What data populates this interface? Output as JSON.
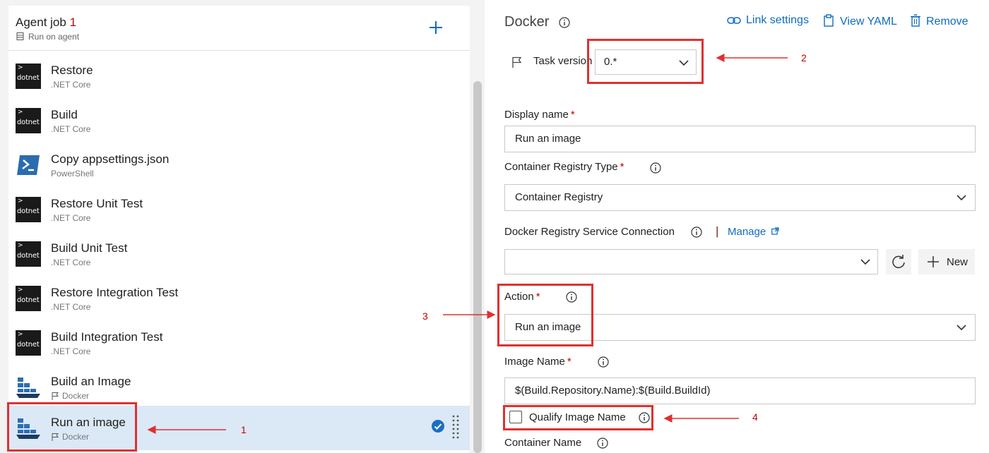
{
  "left": {
    "job": {
      "title": "Agent job",
      "number": "1",
      "subtitle": "Run on agent"
    },
    "tasks": [
      {
        "name": "Restore",
        "subtitle": ".NET Core",
        "icon": "dotnet-icon"
      },
      {
        "name": "Build",
        "subtitle": ".NET Core",
        "icon": "dotnet-icon"
      },
      {
        "name": "Copy appsettings.json",
        "subtitle": "PowerShell",
        "icon": "powershell-icon"
      },
      {
        "name": "Restore Unit Test",
        "subtitle": ".NET Core",
        "icon": "dotnet-icon"
      },
      {
        "name": "Build Unit Test",
        "subtitle": ".NET Core",
        "icon": "dotnet-icon"
      },
      {
        "name": "Restore Integration Test",
        "subtitle": ".NET Core",
        "icon": "dotnet-icon"
      },
      {
        "name": "Build Integration Test",
        "subtitle": ".NET Core",
        "icon": "dotnet-icon"
      },
      {
        "name": "Build an Image",
        "subtitle": "Docker",
        "icon": "docker-icon"
      },
      {
        "name": "Run an image",
        "subtitle": "Docker",
        "icon": "docker-icon",
        "selected": true
      }
    ],
    "dotnet_icon_text": "dotnet"
  },
  "right": {
    "title": "Docker",
    "toolbar": {
      "link_settings": "Link settings",
      "view_yaml": "View YAML",
      "remove": "Remove"
    },
    "task_version": {
      "label": "Task version",
      "value": "0.*"
    },
    "display_name": {
      "label": "Display name",
      "value": "Run an image"
    },
    "container_registry_type": {
      "label": "Container Registry Type",
      "value": "Container Registry"
    },
    "service_connection": {
      "label": "Docker Registry Service Connection",
      "separator": "|",
      "manage": "Manage",
      "value": "",
      "new": "New"
    },
    "action": {
      "label": "Action",
      "value": "Run an image"
    },
    "image_name": {
      "label": "Image Name",
      "value": "$(Build.Repository.Name):$(Build.BuildId)"
    },
    "qualify_image_name": {
      "label": "Qualify Image Name",
      "checked": false
    },
    "container_name": {
      "label": "Container Name"
    },
    "required_mark": "*"
  },
  "annotations": {
    "callout_1": "1",
    "callout_2": "2",
    "callout_3": "3",
    "callout_4": "4"
  },
  "colors": {
    "accent": "#0f6bbf",
    "annotation_red": "#e03030",
    "required_red": "#c00000",
    "selected_row": "#dbe9f6"
  }
}
